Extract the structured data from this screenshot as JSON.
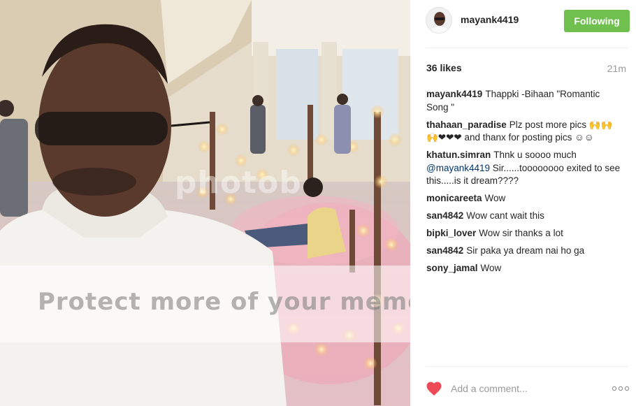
{
  "post": {
    "photo_alt": "Selfie of a man in a white shirt in a decorated hall lit with candles and rose petals",
    "watermark_text": "Protect more of your memo",
    "watermark_logo": "photob"
  },
  "header": {
    "username": "mayank4419",
    "follow_label": "Following",
    "follow_color": "#70c050"
  },
  "stats": {
    "likes": "36 likes",
    "time": "21m"
  },
  "comments": [
    {
      "user": "mayank4419",
      "text": "Thappki -Bihaan \"Romantic Song \""
    },
    {
      "user": "thahaan_paradise",
      "text": "Plz post more pics 🙌🙌🙌❤❤❤ and thanx for posting pics ☺☺"
    },
    {
      "user": "khatun.simran",
      "text": "Thnk u soooo much",
      "mention": "@mayank4419",
      "text_after": " Sir......toooooooo exited to see this.....is it dream????"
    },
    {
      "user": "monicareeta",
      "text": "Wow"
    },
    {
      "user": "san4842",
      "text": "Wow cant wait this"
    },
    {
      "user": "bipki_lover",
      "text": "Wow sir thanks a lot"
    },
    {
      "user": "san4842",
      "text": "Sir paka ya dream nai ho ga"
    },
    {
      "user": "sony_jamal",
      "text": "Wow"
    }
  ],
  "footer": {
    "placeholder": "Add a comment...",
    "like_icon": "heart-icon",
    "more_icon": "more-options-icon"
  },
  "colors": {
    "like_red": "#ed4956",
    "mention_blue": "#003569",
    "muted_gray": "#999999"
  }
}
